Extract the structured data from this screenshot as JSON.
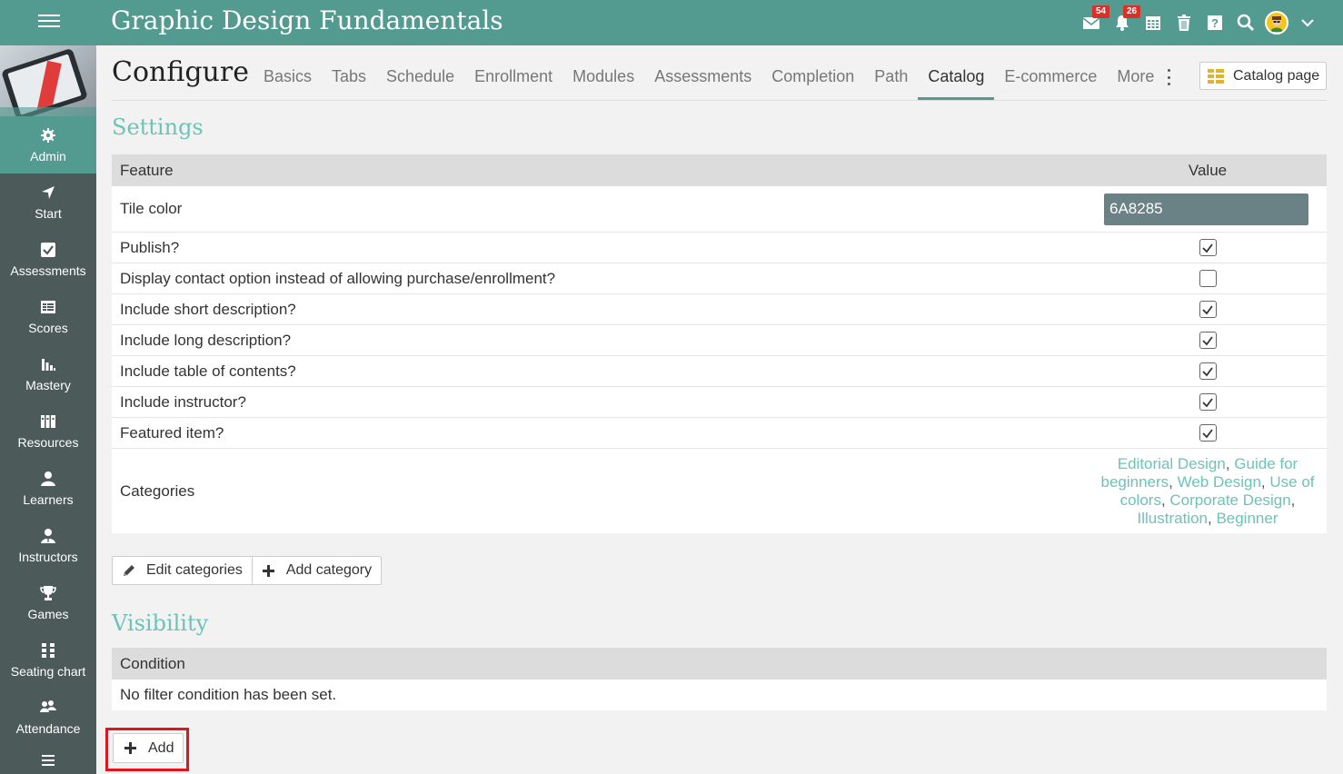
{
  "topbar": {
    "title": "Graphic Design Fundamentals",
    "icons": [
      {
        "name": "mail-icon",
        "badge": "54"
      },
      {
        "name": "bell-icon",
        "badge": "26"
      },
      {
        "name": "calendar-icon",
        "badge": ""
      },
      {
        "name": "trash-icon",
        "badge": ""
      },
      {
        "name": "help-icon",
        "badge": ""
      },
      {
        "name": "search-icon",
        "badge": ""
      }
    ]
  },
  "sidebar": {
    "items": [
      {
        "label": "Admin",
        "icon": "gear-icon",
        "active": true
      },
      {
        "label": "Start",
        "icon": "location-arrow-icon"
      },
      {
        "label": "Assessments",
        "icon": "check-square-icon"
      },
      {
        "label": "Scores",
        "icon": "gradebook-icon"
      },
      {
        "label": "Mastery",
        "icon": "bar-chart-icon"
      },
      {
        "label": "Resources",
        "icon": "library-icon"
      },
      {
        "label": "Learners",
        "icon": "user-icon"
      },
      {
        "label": "Instructors",
        "icon": "instructor-icon"
      },
      {
        "label": "Games",
        "icon": "trophy-icon"
      },
      {
        "label": "Seating chart",
        "icon": "seating-icon"
      },
      {
        "label": "Attendance",
        "icon": "users-icon"
      }
    ]
  },
  "page": {
    "title": "Configure",
    "tabs": [
      "Basics",
      "Tabs",
      "Schedule",
      "Enrollment",
      "Modules",
      "Assessments",
      "Completion",
      "Path",
      "Catalog",
      "E-commerce",
      "More"
    ],
    "active_tab": "Catalog",
    "catalog_page_label": "Catalog page"
  },
  "settings": {
    "title": "Settings",
    "header_feature": "Feature",
    "header_value": "Value",
    "tile_color_label": "Tile color",
    "tile_color_value": "6A8285",
    "checkbox_rows": [
      {
        "label": "Publish?",
        "checked": true
      },
      {
        "label": "Display contact option instead of allowing purchase/enrollment?",
        "checked": false
      },
      {
        "label": "Include short description?",
        "checked": true
      },
      {
        "label": "Include long description?",
        "checked": true
      },
      {
        "label": "Include table of contents?",
        "checked": true
      },
      {
        "label": "Include instructor?",
        "checked": true
      },
      {
        "label": "Featured item?",
        "checked": true
      }
    ],
    "categories_label": "Categories",
    "categories": [
      "Editorial Design",
      "Guide for beginners",
      "Web Design",
      "Use of colors",
      "Corporate Design",
      "Illustration",
      "Beginner"
    ],
    "edit_categories_label": "Edit categories",
    "add_category_label": "Add category"
  },
  "visibility": {
    "title": "Visibility",
    "header_condition": "Condition",
    "empty_text": "No filter condition has been set.",
    "add_label": "Add"
  },
  "colors": {
    "accent": "#539a91",
    "accent_light": "#6cc3b8",
    "sidebar_bg": "#4d5a5a",
    "tile_color": "#6A8285",
    "highlight": "#e3141e"
  }
}
